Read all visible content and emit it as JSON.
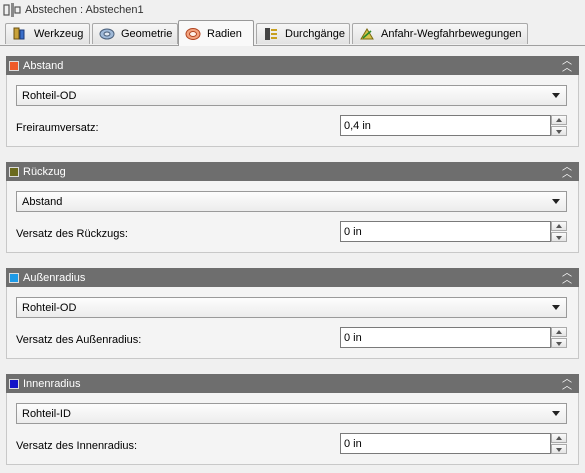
{
  "window": {
    "title": "Abstechen : Abstechen1"
  },
  "tabs": [
    {
      "label": "Werkzeug",
      "icon": "tool-icon"
    },
    {
      "label": "Geometrie",
      "icon": "geometry-icon"
    },
    {
      "label": "Radien",
      "icon": "radii-icon",
      "active": true
    },
    {
      "label": "Durchgänge",
      "icon": "passes-icon"
    },
    {
      "label": "Anfahr-Wegfahrbewegungen",
      "icon": "linking-icon"
    }
  ],
  "sections": [
    {
      "title": "Abstand",
      "color": "#f05a28",
      "select": "Rohteil-OD",
      "field_label": "Freiraumversatz:",
      "value": "0,4 in"
    },
    {
      "title": "Rückzug",
      "color": "#6b6a1e",
      "select": "Abstand",
      "field_label": "Versatz des Rückzugs:",
      "value": "0 in"
    },
    {
      "title": "Außenradius",
      "color": "#1e9be8",
      "select": "Rohteil-OD",
      "field_label": "Versatz des Außenradius:",
      "value": "0 in"
    },
    {
      "title": "Innenradius",
      "color": "#1414c8",
      "select": "Rohteil-ID",
      "field_label": "Versatz des Innenradius:",
      "value": "0 in"
    }
  ]
}
